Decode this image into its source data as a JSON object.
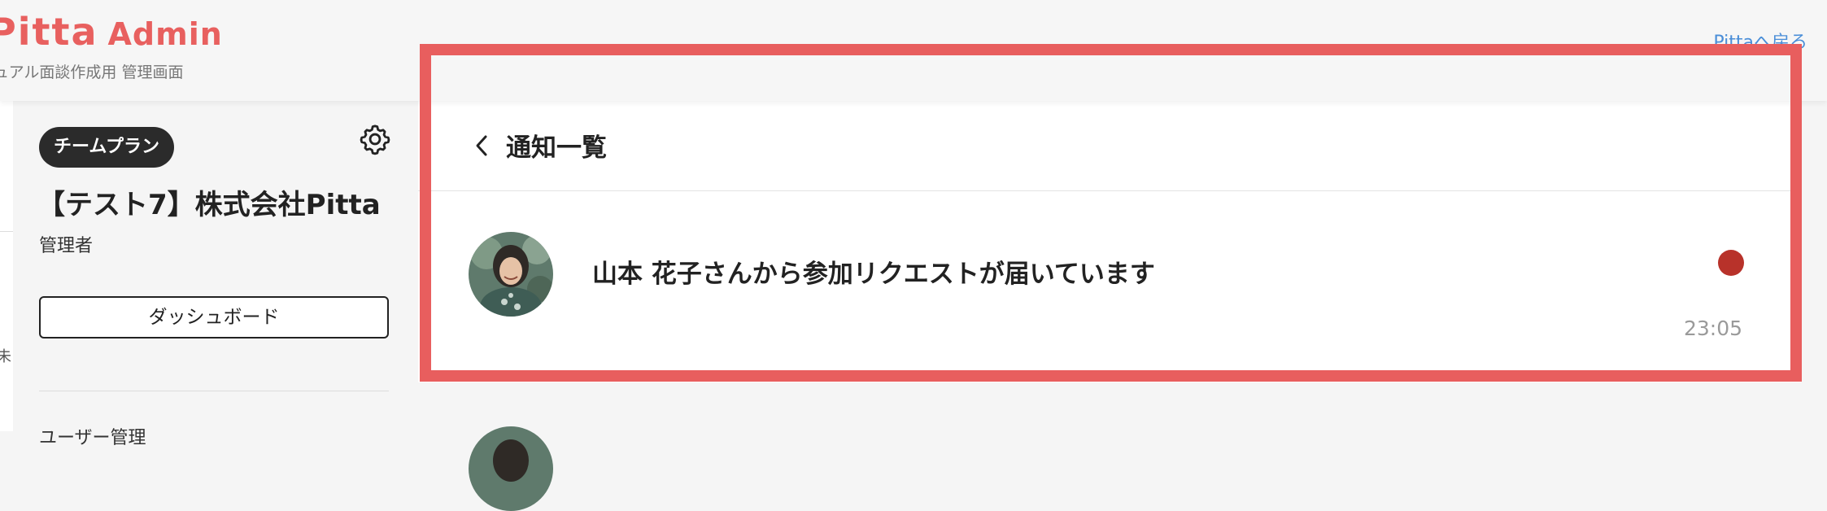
{
  "header": {
    "brand": "Pitta",
    "brand_suffix": "Admin",
    "subtitle": "ュアル面談作成用 管理画面",
    "back_link": "Pittaへ戻る",
    "brand_color": "#e8605f"
  },
  "left_edge": {
    "char": "未"
  },
  "sidebar": {
    "plan_badge": "チームプラン",
    "settings_icon": "gear-icon",
    "org_name": "【テスト7】株式会社Pitta",
    "role": "管理者",
    "dashboard_button": "ダッシュボード",
    "next_item_partial": "ユーザー管理"
  },
  "main": {
    "back_icon": "chevron-left-icon",
    "title": "通知一覧",
    "notifications": [
      {
        "avatar_icon": "user-avatar",
        "text": "山本 花子さんから参加リクエストが届いています",
        "time": "23:05",
        "unread": true,
        "unread_color": "#b8322a"
      }
    ]
  },
  "highlight_color": "#e85e5e"
}
